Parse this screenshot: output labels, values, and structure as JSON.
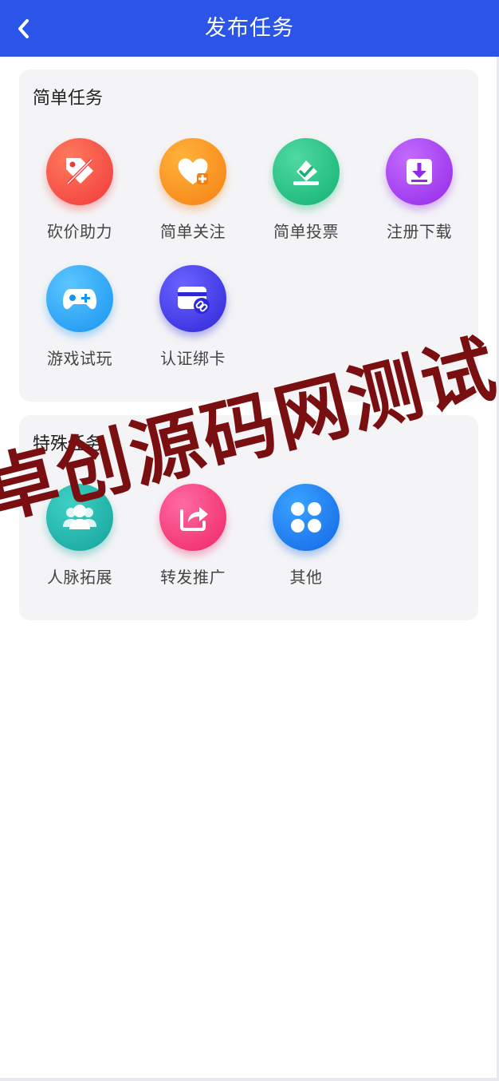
{
  "header": {
    "title": "发布任务",
    "background": "#2a55e8",
    "back_icon": "chevron-left-icon"
  },
  "sections": [
    {
      "title": "简单任务",
      "items": [
        {
          "label": "砍价助力",
          "icon": "price-tag-icon",
          "color": "#f54a45"
        },
        {
          "label": "简单关注",
          "icon": "heart-plus-icon",
          "color": "#f59419"
        },
        {
          "label": "简单投票",
          "icon": "vote-box-icon",
          "color": "#21c284"
        },
        {
          "label": "注册下载",
          "icon": "download-icon",
          "color": "#a53ef0"
        },
        {
          "label": "游戏试玩",
          "icon": "gamepad-icon",
          "color": "#22a4f5"
        },
        {
          "label": "认证绑卡",
          "icon": "card-link-icon",
          "color": "#3d3ce8"
        }
      ]
    },
    {
      "title": "特殊任务",
      "items": [
        {
          "label": "人脉拓展",
          "icon": "contacts-icon",
          "color": "#1aaea6"
        },
        {
          "label": "转发推广",
          "icon": "share-icon",
          "color": "#f43a7a"
        },
        {
          "label": "其他",
          "icon": "clover-icon",
          "color": "#1877ee"
        }
      ]
    }
  ],
  "watermark": "卓创源码网测试"
}
